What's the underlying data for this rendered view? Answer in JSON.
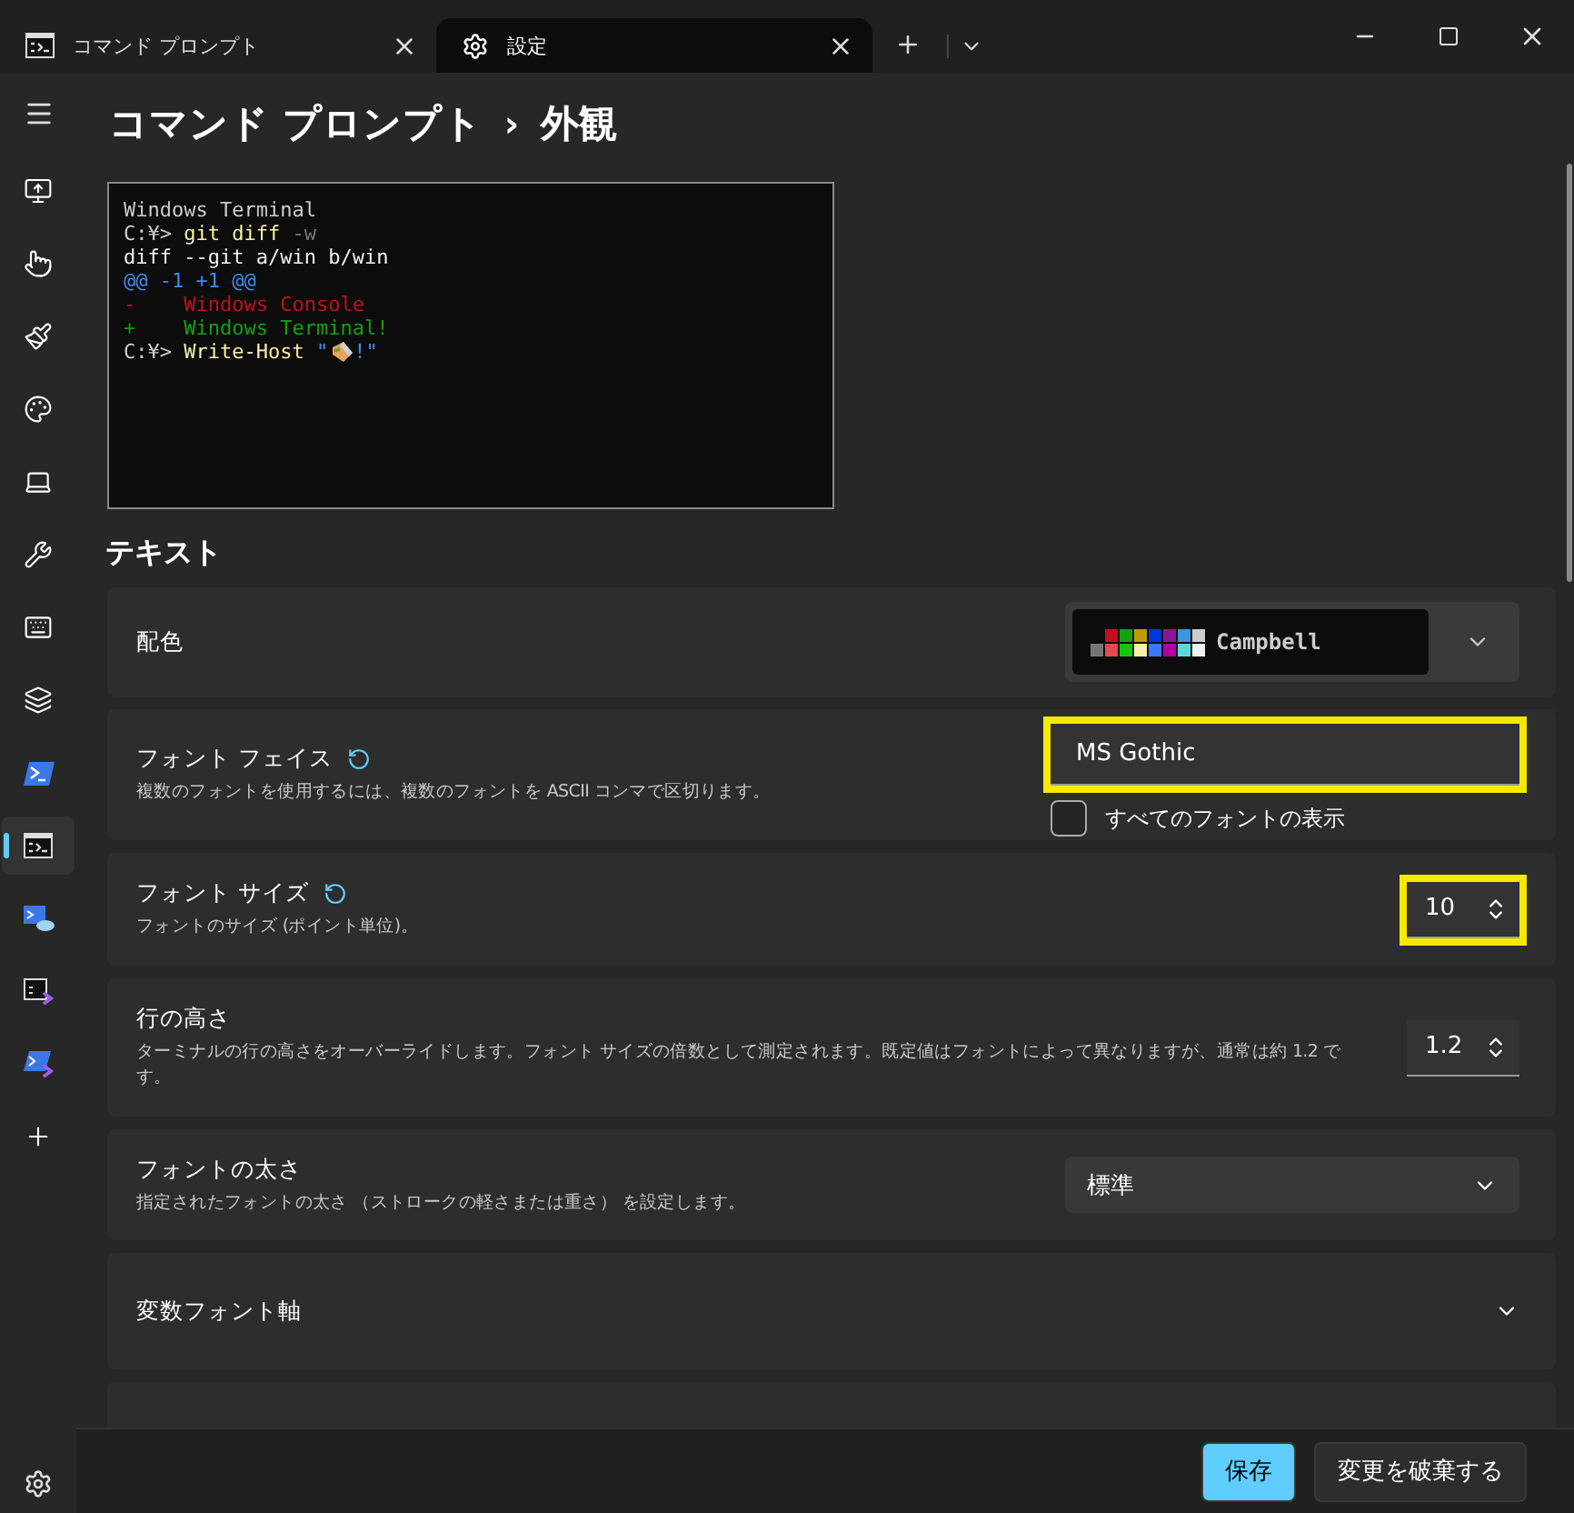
{
  "tabs": [
    {
      "label": "コマンド プロンプト",
      "kind": "console",
      "selected": false
    },
    {
      "label": "設定",
      "kind": "settings",
      "selected": true
    }
  ],
  "breadcrumb": {
    "parent": "コマンド プロンプト",
    "separator": "›",
    "current": "外観"
  },
  "sidebar": {
    "items": [
      {
        "kind": "startup",
        "selected": false
      },
      {
        "kind": "interaction",
        "selected": false
      },
      {
        "kind": "appearance",
        "selected": false
      },
      {
        "kind": "color",
        "selected": false
      },
      {
        "kind": "rendering",
        "selected": false
      },
      {
        "kind": "actions",
        "selected": false
      },
      {
        "kind": "keyboard",
        "selected": false
      },
      {
        "kind": "defaults",
        "selected": false
      },
      {
        "kind": "powershell",
        "selected": false
      },
      {
        "kind": "console",
        "selected": true
      },
      {
        "kind": "cloud",
        "selected": false
      },
      {
        "kind": "devcmd",
        "selected": false
      },
      {
        "kind": "devps",
        "selected": false
      },
      {
        "kind": "add",
        "selected": false
      }
    ]
  },
  "preview": {
    "lines": [
      [
        {
          "kind": "text",
          "text": "Windows Terminal",
          "color": "#cccccc"
        }
      ],
      [
        {
          "kind": "text",
          "text": "C:¥> ",
          "color": "#cccccc"
        },
        {
          "kind": "text",
          "text": "git diff ",
          "color": "#f9f1a5"
        },
        {
          "kind": "text",
          "text": "-w",
          "color": "#767676"
        }
      ],
      [
        {
          "kind": "text",
          "text": "diff --git a/win b/win",
          "color": "#f2f2f2"
        }
      ],
      [
        {
          "kind": "text",
          "text": "@@ -1 +1 @@",
          "color": "#3b8eea"
        }
      ],
      [
        {
          "kind": "text",
          "text": "-    Windows Console",
          "color": "#c50f1f"
        }
      ],
      [
        {
          "kind": "text",
          "text": "+    Windows Terminal!",
          "color": "#13a10e"
        }
      ],
      [
        {
          "kind": "text",
          "text": "C:¥> ",
          "color": "#cccccc"
        },
        {
          "kind": "text",
          "text": "Write-Host ",
          "color": "#f9f1a5"
        },
        {
          "kind": "text",
          "text": "\"",
          "color": "#3b8eea"
        },
        {
          "kind": "emoji"
        },
        {
          "kind": "text",
          "text": "!\"",
          "color": "#3b8eea"
        }
      ]
    ]
  },
  "section_title": "テキスト",
  "settings": [
    {
      "kind": "scheme",
      "label": "配色",
      "scheme": "Campbell",
      "swatches": [
        {
          "color": "#c50f1f"
        },
        {
          "color": "#13a10e"
        },
        {
          "color": "#c19c00"
        },
        {
          "color": "#0037da"
        },
        {
          "color": "#881798"
        },
        {
          "color": "#3a96dd"
        },
        {
          "color": "#cccccc"
        },
        {
          "color": "#767676"
        },
        {
          "color": "#e74856"
        },
        {
          "color": "#16c60c"
        },
        {
          "color": "#f9f1a5"
        },
        {
          "color": "#3b78ff"
        },
        {
          "color": "#b4009e"
        },
        {
          "color": "#61d6d6"
        },
        {
          "color": "#f2f2f2"
        }
      ]
    },
    {
      "kind": "fontface",
      "label": "フォント フェイス",
      "reset": true,
      "description": "複数のフォントを使用するには、複数のフォントを ASCII コンマで区切ります。",
      "value": "MS Gothic",
      "highlighted": true,
      "checkbox": {
        "label": "すべてのフォントの表示",
        "checked": false
      }
    },
    {
      "kind": "number",
      "label": "フォント サイズ",
      "reset": true,
      "description": "フォントのサイズ (ポイント単位)。",
      "value": "10",
      "highlighted": true
    },
    {
      "kind": "number",
      "label": "行の高さ",
      "reset": false,
      "description": "ターミナルの行の高さをオーバーライドします。フォント サイズの倍数として測定されます。既定値はフォントによって異なりますが、通常は約 1.2 です。",
      "value": "1.2",
      "highlighted": false
    },
    {
      "kind": "dropdown",
      "label": "フォントの太さ",
      "description": "指定されたフォントの太さ （ストロークの軽さまたは重さ） を設定します。",
      "value": "標準"
    },
    {
      "kind": "expander",
      "label": "変数フォント軸",
      "expanded": false
    },
    {
      "kind": "hidden"
    }
  ],
  "footer": {
    "save": "保存",
    "discard": "変更を破棄する"
  }
}
